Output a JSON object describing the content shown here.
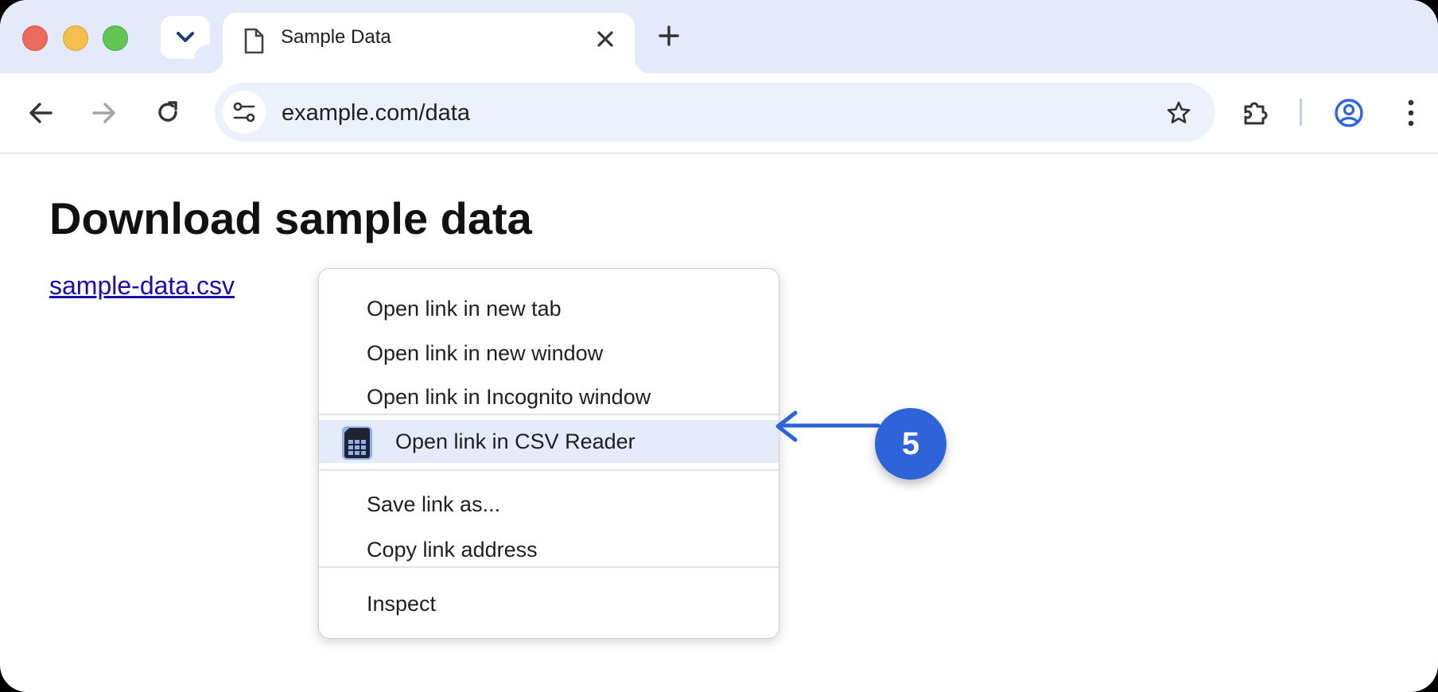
{
  "colors": {
    "tabstrip_bg": "#e3eafb",
    "accent_blue": "#2f63d8",
    "link": "#1a0dab",
    "highlight": "#e4ebfb"
  },
  "tab": {
    "title": "Sample Data",
    "icon": "document-icon"
  },
  "toolbar": {
    "url": "example.com/data"
  },
  "page": {
    "heading": "Download sample data",
    "link_text": "sample-data.csv"
  },
  "context_menu": {
    "items": [
      "Open link in new tab",
      "Open link in new window",
      "Open link in Incognito window",
      "Open link in CSV Reader",
      "Save link as...",
      "Copy link address",
      "Inspect"
    ],
    "highlighted_item": "Open link in CSV Reader",
    "highlighted_icon": "csv-reader-icon"
  },
  "annotation": {
    "step_number": "5"
  }
}
